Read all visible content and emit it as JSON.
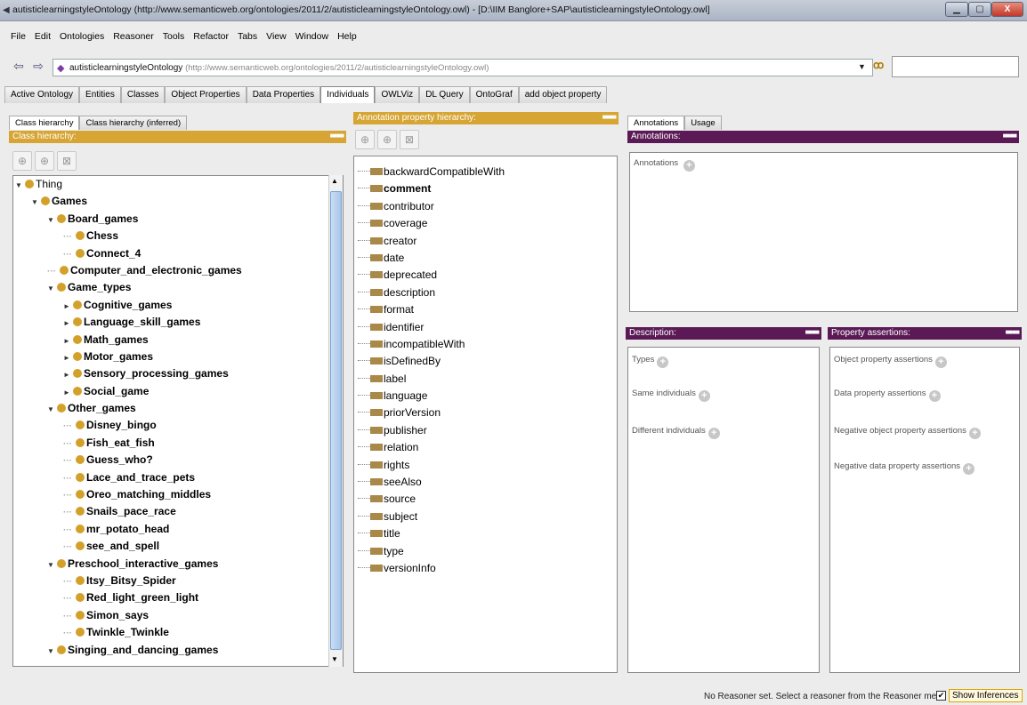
{
  "window": {
    "title": "autisticlearningstyleOntology (http://www.semanticweb.org/ontologies/2011/2/autisticlearningstyleOntology.owl) - [D:\\IIM Banglore+SAP\\autisticlearningstyleOntology.owl]",
    "min_icon": "minimize-icon",
    "max_icon": "maximize-icon",
    "close_label": "X"
  },
  "menu": [
    "File",
    "Edit",
    "Ontologies",
    "Reasoner",
    "Tools",
    "Refactor",
    "Tabs",
    "View",
    "Window",
    "Help"
  ],
  "address": {
    "ontology_name": "autisticlearningstyleOntology",
    "ontology_iri": "(http://www.semanticweb.org/ontologies/2011/2/autisticlearningstyleOntology.owl)",
    "search_value": ""
  },
  "tabs": [
    "Active Ontology",
    "Entities",
    "Classes",
    "Object Properties",
    "Data Properties",
    "Individuals",
    "OWLViz",
    "DL Query",
    "OntoGraf",
    "add object property"
  ],
  "active_tab": "Individuals",
  "class_panel": {
    "subtabs": [
      "Class hierarchy",
      "Class hierarchy (inferred)"
    ],
    "header": "Class hierarchy:",
    "tree": [
      {
        "label": "Thing",
        "level": 0,
        "expander": "▼",
        "bold": false
      },
      {
        "label": "Games",
        "level": 1,
        "expander": "▼"
      },
      {
        "label": "Board_games",
        "level": 2,
        "expander": "▼"
      },
      {
        "label": "Chess",
        "level": 3,
        "expander": ""
      },
      {
        "label": "Connect_4",
        "level": 3,
        "expander": ""
      },
      {
        "label": "Computer_and_electronic_games",
        "level": 2,
        "expander": ""
      },
      {
        "label": "Game_types",
        "level": 2,
        "expander": "▼"
      },
      {
        "label": "Cognitive_games",
        "level": 3,
        "expander": "►"
      },
      {
        "label": "Language_skill_games",
        "level": 3,
        "expander": "►"
      },
      {
        "label": "Math_games",
        "level": 3,
        "expander": "►"
      },
      {
        "label": "Motor_games",
        "level": 3,
        "expander": "►"
      },
      {
        "label": "Sensory_processing_games",
        "level": 3,
        "expander": "►"
      },
      {
        "label": "Social_game",
        "level": 3,
        "expander": "►"
      },
      {
        "label": "Other_games",
        "level": 2,
        "expander": "▼"
      },
      {
        "label": "Disney_bingo",
        "level": 3,
        "expander": ""
      },
      {
        "label": "Fish_eat_fish",
        "level": 3,
        "expander": ""
      },
      {
        "label": "Guess_who?",
        "level": 3,
        "expander": ""
      },
      {
        "label": "Lace_and_trace_pets",
        "level": 3,
        "expander": ""
      },
      {
        "label": "Oreo_matching_middles",
        "level": 3,
        "expander": ""
      },
      {
        "label": "Snails_pace_race",
        "level": 3,
        "expander": ""
      },
      {
        "label": "mr_potato_head",
        "level": 3,
        "expander": ""
      },
      {
        "label": "see_and_spell",
        "level": 3,
        "expander": ""
      },
      {
        "label": "Preschool_interactive_games",
        "level": 2,
        "expander": "▼"
      },
      {
        "label": "Itsy_Bitsy_Spider",
        "level": 3,
        "expander": ""
      },
      {
        "label": "Red_light_green_light",
        "level": 3,
        "expander": ""
      },
      {
        "label": "Simon_says",
        "level": 3,
        "expander": ""
      },
      {
        "label": "Twinkle_Twinkle",
        "level": 3,
        "expander": ""
      },
      {
        "label": "Singing_and_dancing_games",
        "level": 2,
        "expander": "▼"
      }
    ]
  },
  "annotation_panel": {
    "header": "Annotation property hierarchy:",
    "items": [
      "backwardCompatibleWith",
      "comment",
      "contributor",
      "coverage",
      "creator",
      "date",
      "deprecated",
      "description",
      "format",
      "identifier",
      "incompatibleWith",
      "isDefinedBy",
      "label",
      "language",
      "priorVersion",
      "publisher",
      "relation",
      "rights",
      "seeAlso",
      "source",
      "subject",
      "title",
      "type",
      "versionInfo"
    ],
    "bold_item": "comment"
  },
  "right_tabs": [
    "Annotations",
    "Usage"
  ],
  "annotations_panel": {
    "header": "Annotations:",
    "label": "Annotations"
  },
  "description_panel": {
    "header": "Description:",
    "items": [
      "Types",
      "Same individuals",
      "Different individuals"
    ]
  },
  "property_panel": {
    "header": "Property assertions:",
    "items": [
      "Object property assertions",
      "Data property assertions",
      "Negative object property assertions",
      "Negative data property assertions"
    ]
  },
  "status": {
    "text": "No Reasoner set. Select a reasoner from the Reasoner menu",
    "show_inferences": "Show Inferences",
    "checked": true
  },
  "colors": {
    "class_header": "#d6a534",
    "panel_header": "#5b1a55",
    "class_dot": "#d3a02a"
  }
}
